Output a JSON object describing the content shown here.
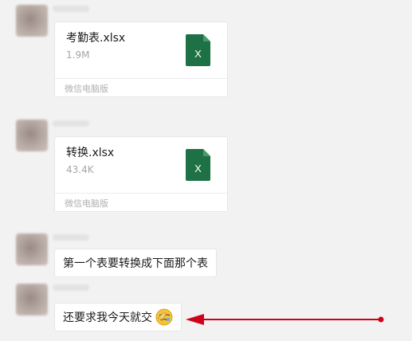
{
  "messages": [
    {
      "type": "file",
      "file_name": "考勤表.xlsx",
      "file_size": "1.9M",
      "file_icon": "excel-file-icon",
      "file_icon_letter": "X",
      "source": "微信电脑版"
    },
    {
      "type": "file",
      "file_name": "转换.xlsx",
      "file_size": "43.4K",
      "file_icon": "excel-file-icon",
      "file_icon_letter": "X",
      "source": "微信电脑版"
    },
    {
      "type": "text",
      "text": "第一个表要转换成下面那个表"
    },
    {
      "type": "text",
      "text": "还要求我今天就交",
      "emoji": "facepalm-emoji"
    }
  ],
  "colors": {
    "background": "#f2f2f2",
    "bubble": "#ffffff",
    "excel_green": "#1d7145",
    "annotation_arrow": "#d0021b"
  },
  "annotation": {
    "type": "red-arrow",
    "points_to": "还要求我今天就交"
  }
}
